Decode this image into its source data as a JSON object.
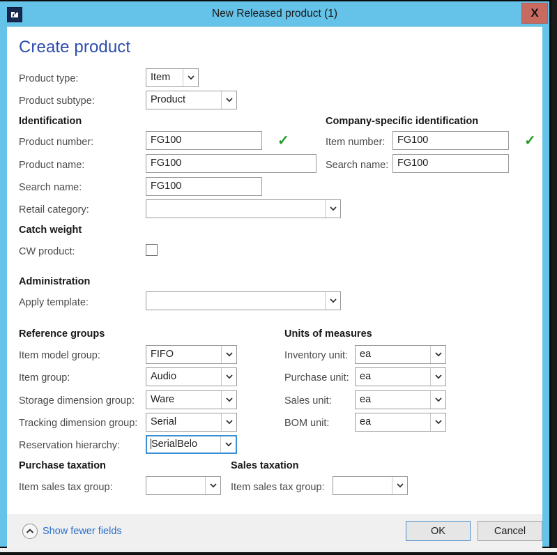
{
  "window": {
    "title": "New Released product (1)",
    "app_icon": "dynamics-app-icon",
    "close_label": "X",
    "titlebar_color": "#65c2e8",
    "close_color": "#c96a61"
  },
  "page_title": "Create product",
  "accent_color": "#2f4dab",
  "valid_color": "#1f9b22",
  "link_color": "#2a6fc9",
  "top_fields": [
    {
      "label": "Product type:",
      "value": "Item"
    },
    {
      "label": "Product subtype:",
      "value": "Product"
    }
  ],
  "identification": {
    "heading": "Identification",
    "fields": [
      {
        "label": "Product number:",
        "value": "FG100",
        "valid": "✓"
      },
      {
        "label": "Product name:",
        "value": "FG100"
      },
      {
        "label": "Search name:",
        "value": "FG100"
      },
      {
        "label": "Retail category:",
        "value": ""
      }
    ]
  },
  "company_identification": {
    "heading": "Company-specific identification",
    "fields": [
      {
        "label": "Item number:",
        "value": "FG100",
        "valid": "✓"
      },
      {
        "label": "Search name:",
        "value": "FG100"
      }
    ]
  },
  "catch_weight": {
    "heading": "Catch weight",
    "checkbox_label": "CW product:",
    "checked": false
  },
  "administration": {
    "heading": "Administration",
    "fields": [
      {
        "label": "Apply template:",
        "value": ""
      }
    ]
  },
  "reference_groups": {
    "heading": "Reference groups",
    "fields": [
      {
        "label": "Item model group:",
        "value": "FIFO"
      },
      {
        "label": "Item group:",
        "value": "Audio"
      },
      {
        "label": "Storage dimension group:",
        "value": "Ware"
      },
      {
        "label": "Tracking dimension group:",
        "value": "Serial"
      },
      {
        "label": "Reservation hierarchy:",
        "value": "SerialBelo",
        "focused": true
      }
    ]
  },
  "units_of_measures": {
    "heading": "Units of measures",
    "fields": [
      {
        "label": "Inventory unit:",
        "value": "ea"
      },
      {
        "label": "Purchase unit:",
        "value": "ea"
      },
      {
        "label": "Sales unit:",
        "value": "ea"
      },
      {
        "label": "BOM unit:",
        "value": "ea"
      }
    ]
  },
  "purchase_taxation": {
    "heading": "Purchase taxation",
    "fields": [
      {
        "label": "Item sales tax group:",
        "value": ""
      }
    ]
  },
  "sales_taxation": {
    "heading": "Sales taxation",
    "fields": [
      {
        "label": "Item sales tax group:",
        "value": ""
      }
    ]
  },
  "footer": {
    "show_fewer_label": "Show fewer fields",
    "show_fewer_icon": "chevron-up-circle-icon",
    "ok_label": "OK",
    "cancel_label": "Cancel"
  }
}
